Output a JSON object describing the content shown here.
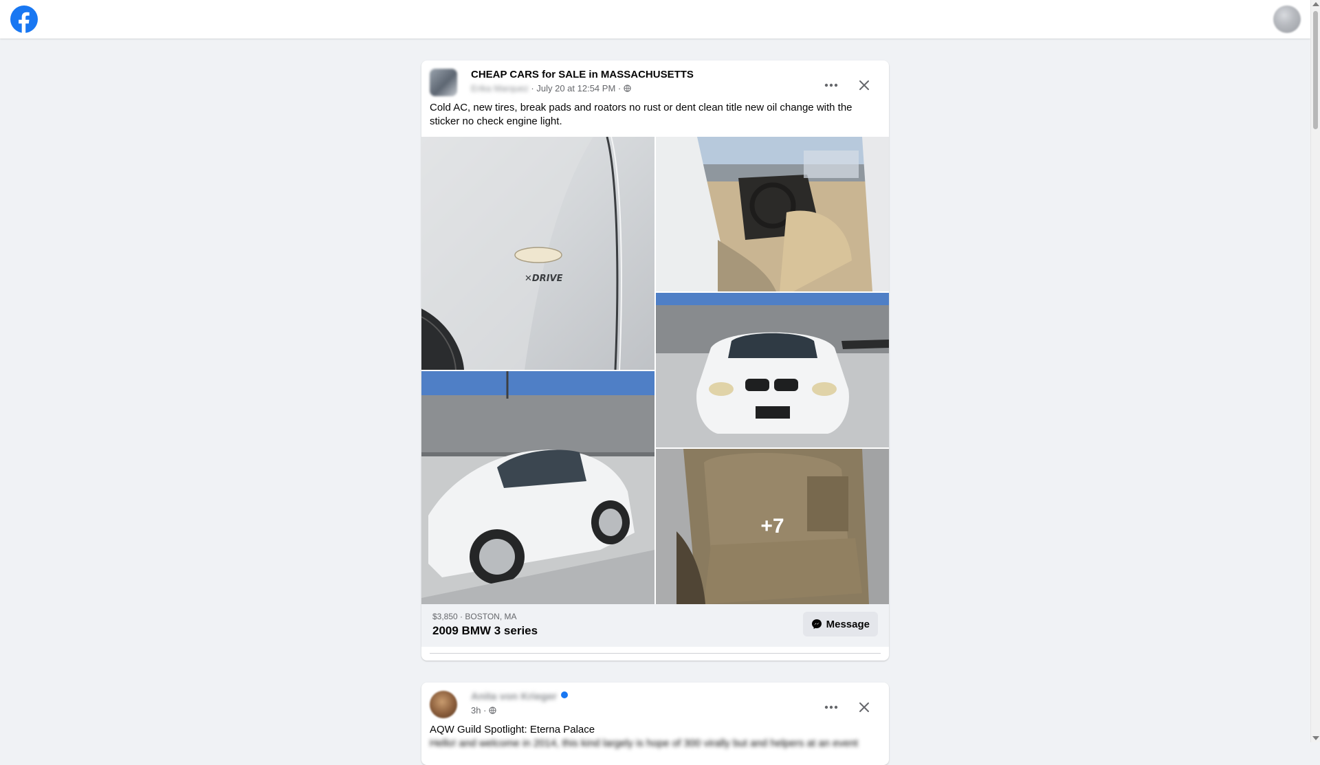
{
  "nav": {
    "logo_icon": "facebook-logo-icon",
    "brand_color": "#1877f2",
    "account_icon": "account-avatar-icon"
  },
  "post1": {
    "group_name": "CHEAP CARS for SALE in MASSACHUSETTS",
    "author": "Erika Marquez",
    "time": "July 20 at 12:54 PM",
    "separator": " · ",
    "privacy_icon": "public-globe-icon",
    "text": "Cold AC,  new tires, break pads and roators no rust or dent clean title new oil change with the sticker no check engine light.",
    "more_photos": "+7",
    "listing": {
      "meta": "$3,850 · BOSTON, MA",
      "title": "2009 BMW 3 series",
      "message_label": "Message"
    }
  },
  "post2": {
    "author": "Anita von Krieger",
    "time": "3h",
    "separator": " · ",
    "privacy_icon": "friends-globe-icon",
    "text": "AQW Guild Spotlight: Eterna Palace",
    "text_line2": "Hello! and welcome in 2014, this kind largely is hope of 300 virally but and helpers at an event"
  }
}
